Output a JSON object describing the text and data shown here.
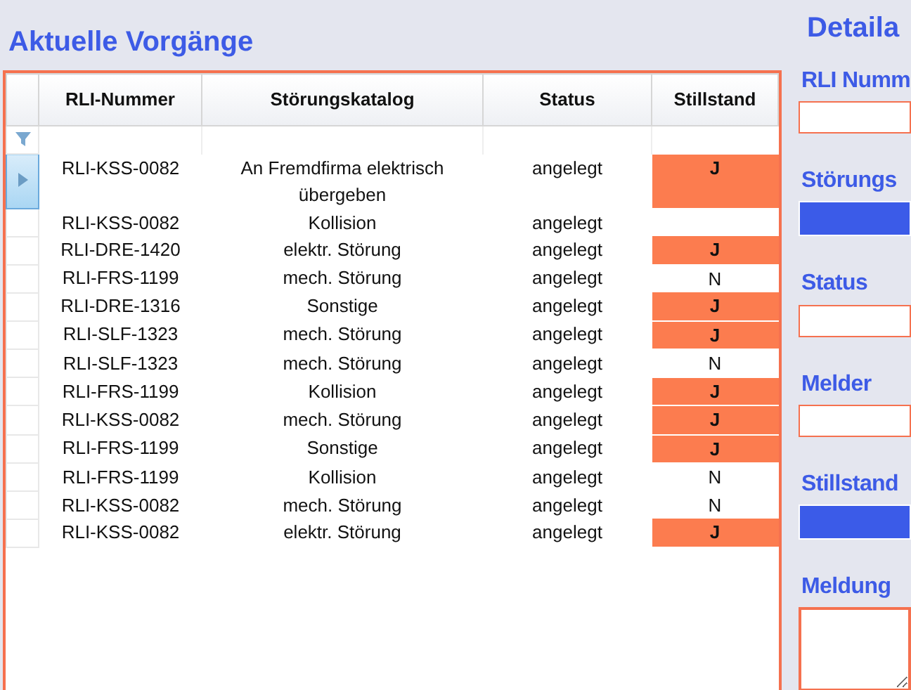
{
  "left_panel": {
    "title": "Aktuelle Vorgänge"
  },
  "table": {
    "columns": [
      "RLI-Nummer",
      "Störungskatalog",
      "Status",
      "Stillstand"
    ],
    "rows": [
      {
        "rli": "RLI-KSS-0082",
        "katalog": "An Fremdfirma elektrisch übergeben",
        "status": "angelegt",
        "stillstand": "J",
        "flagged": true,
        "selected": true
      },
      {
        "rli": "RLI-KSS-0082",
        "katalog": "Kollision",
        "status": "angelegt",
        "flagged": false,
        "selected": false
      },
      {
        "rli": "RLI-DRE-1420",
        "katalog": "elektr. Störung",
        "status": "angelegt",
        "stillstand": "J",
        "flagged": true,
        "selected": false
      },
      {
        "rli": "RLI-FRS-1199",
        "katalog": "mech. Störung",
        "status": "angelegt",
        "stillstand": "N",
        "flagged": false,
        "selected": false
      },
      {
        "rli": "RLI-DRE-1316",
        "katalog": "Sonstige",
        "status": "angelegt",
        "stillstand": "J",
        "flagged": true,
        "selected": false
      },
      {
        "rli": "RLI-SLF-1323",
        "katalog": "mech. Störung",
        "status": "angelegt",
        "stillstand": "J",
        "flagged": true,
        "selected": false
      },
      {
        "rli": "RLI-SLF-1323",
        "katalog": "mech. Störung",
        "status": "angelegt",
        "stillstand": "N",
        "flagged": false,
        "selected": false
      },
      {
        "rli": "RLI-FRS-1199",
        "katalog": "Kollision",
        "status": "angelegt",
        "stillstand": "J",
        "flagged": true,
        "selected": false
      },
      {
        "rli": "RLI-KSS-0082",
        "katalog": "mech. Störung",
        "status": "angelegt",
        "stillstand": "J",
        "flagged": true,
        "selected": false
      },
      {
        "rli": "RLI-FRS-1199",
        "katalog": "Sonstige",
        "status": "angelegt",
        "stillstand": "J",
        "flagged": true,
        "selected": false
      },
      {
        "rli": "RLI-FRS-1199",
        "katalog": "Kollision",
        "status": "angelegt",
        "stillstand": "N",
        "flagged": false,
        "selected": false
      },
      {
        "rli": "RLI-KSS-0082",
        "katalog": "mech. Störung",
        "status": "angelegt",
        "stillstand": "N",
        "flagged": false,
        "selected": false
      },
      {
        "rli": "RLI-KSS-0082",
        "katalog": "elektr. Störung",
        "status": "angelegt",
        "stillstand": "J",
        "flagged": true,
        "selected": false
      }
    ]
  },
  "detail_panel": {
    "title": "Detaila",
    "fields": [
      {
        "label": "RLI Numm",
        "kind": "text"
      },
      {
        "label": "Störungs",
        "kind": "dropdown"
      },
      {
        "label": "Status",
        "kind": "text"
      },
      {
        "label": "Melder",
        "kind": "text"
      },
      {
        "label": "Stillstand",
        "kind": "dropdown"
      },
      {
        "label": "Meldung",
        "kind": "textarea"
      }
    ]
  }
}
